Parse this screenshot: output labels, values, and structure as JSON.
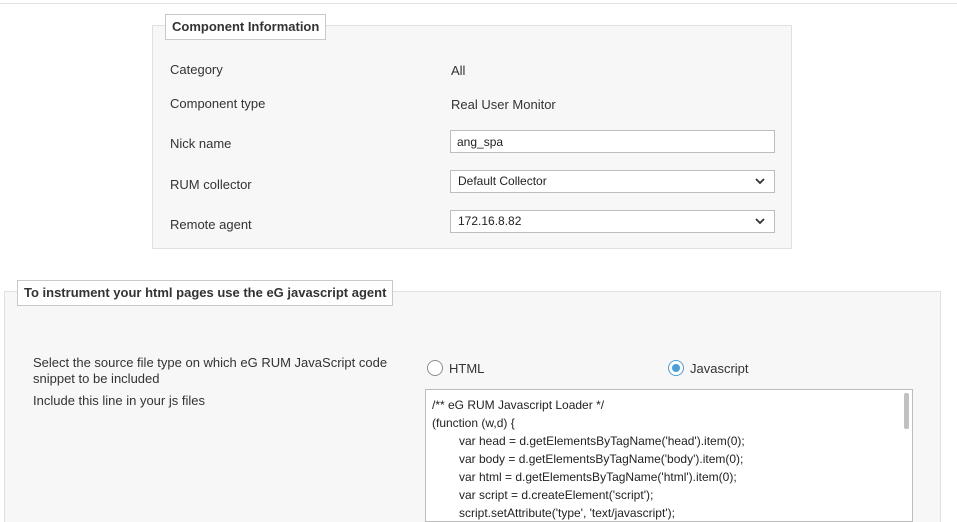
{
  "component_info": {
    "legend": "Component Information",
    "rows": [
      {
        "label": "Category",
        "value": "All"
      },
      {
        "label": "Component type",
        "value": "Real User Monitor"
      },
      {
        "label": "Nick name",
        "value": "ang_spa"
      },
      {
        "label": "RUM collector",
        "value": "Default Collector"
      },
      {
        "label": "Remote agent",
        "value": "172.16.8.82"
      }
    ]
  },
  "instrument": {
    "legend": "To instrument your html pages use the eG javascript agent",
    "source_type_label": "Select the source file type on which eG RUM JavaScript code snippet to be included",
    "options": [
      {
        "label": "HTML",
        "checked": false
      },
      {
        "label": "Javascript",
        "checked": true
      }
    ],
    "include_label": "Include this line in your js files",
    "code_lines": [
      "/** eG RUM Javascript Loader */",
      "(function (w,d) {",
      "var head = d.getElementsByTagName('head').item(0);",
      "var body = d.getElementsByTagName('body').item(0);",
      "var html = d.getElementsByTagName('html').item(0);",
      "var script = d.createElement('script');",
      "script.setAttribute('type', 'text/javascript');"
    ]
  },
  "colors": {
    "accent": "#4a9fd5",
    "panel_bg": "#f7f7f7"
  },
  "icons": {
    "select_arrow": "chevron-down-icon"
  }
}
